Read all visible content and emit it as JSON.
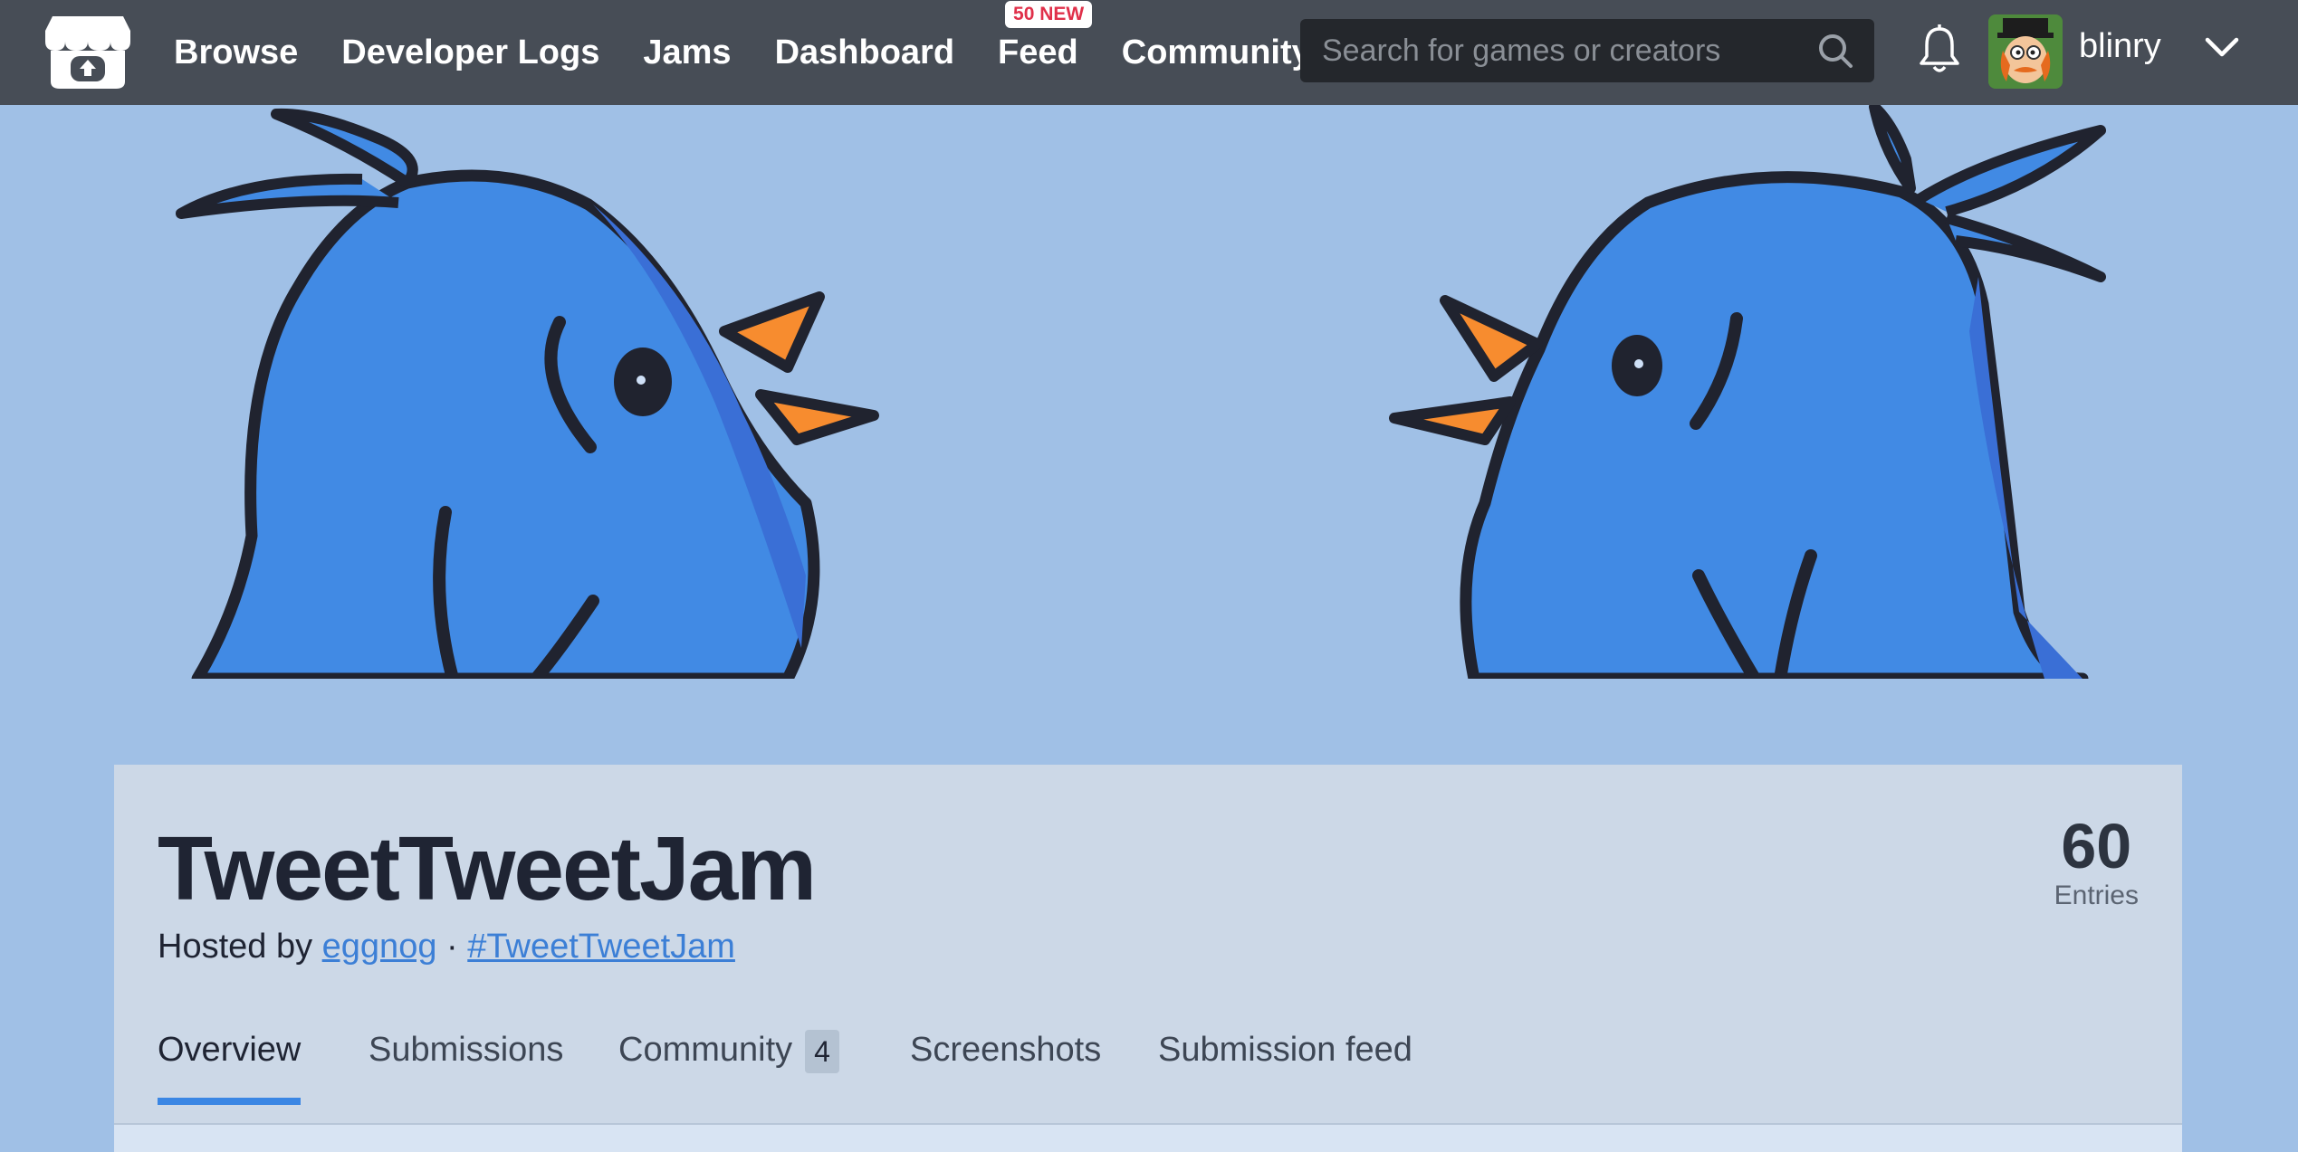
{
  "header": {
    "nav": [
      {
        "label": "Browse"
      },
      {
        "label": "Developer Logs"
      },
      {
        "label": "Jams"
      },
      {
        "label": "Dashboard"
      },
      {
        "label": "Feed",
        "badge": "50 NEW"
      },
      {
        "label": "Community"
      }
    ],
    "search": {
      "placeholder": "Search for games or creators",
      "value": ""
    },
    "user": {
      "name": "blinry"
    },
    "icons": [
      "itchio-logo-icon",
      "search-icon",
      "bell-icon",
      "avatar",
      "chevron-down-icon"
    ]
  },
  "jam": {
    "title": "TweetTweetJam",
    "hosted_prefix": "Hosted by",
    "host": "eggnog",
    "separator": "·",
    "hashtag": "#TweetTweetJam",
    "entries_count": "60",
    "entries_label": "Entries",
    "tabs": [
      {
        "label": "Overview",
        "active": true
      },
      {
        "label": "Submissions"
      },
      {
        "label": "Community",
        "count": "4"
      },
      {
        "label": "Screenshots"
      },
      {
        "label": "Submission feed"
      }
    ]
  },
  "colors": {
    "header_bg": "#474d56",
    "banner_bg": "#a0c0e6",
    "bird_blue": "#418ae4",
    "beak_orange": "#f78c2f",
    "accent": "#3a86e4",
    "badge_text": "#e0304a"
  }
}
